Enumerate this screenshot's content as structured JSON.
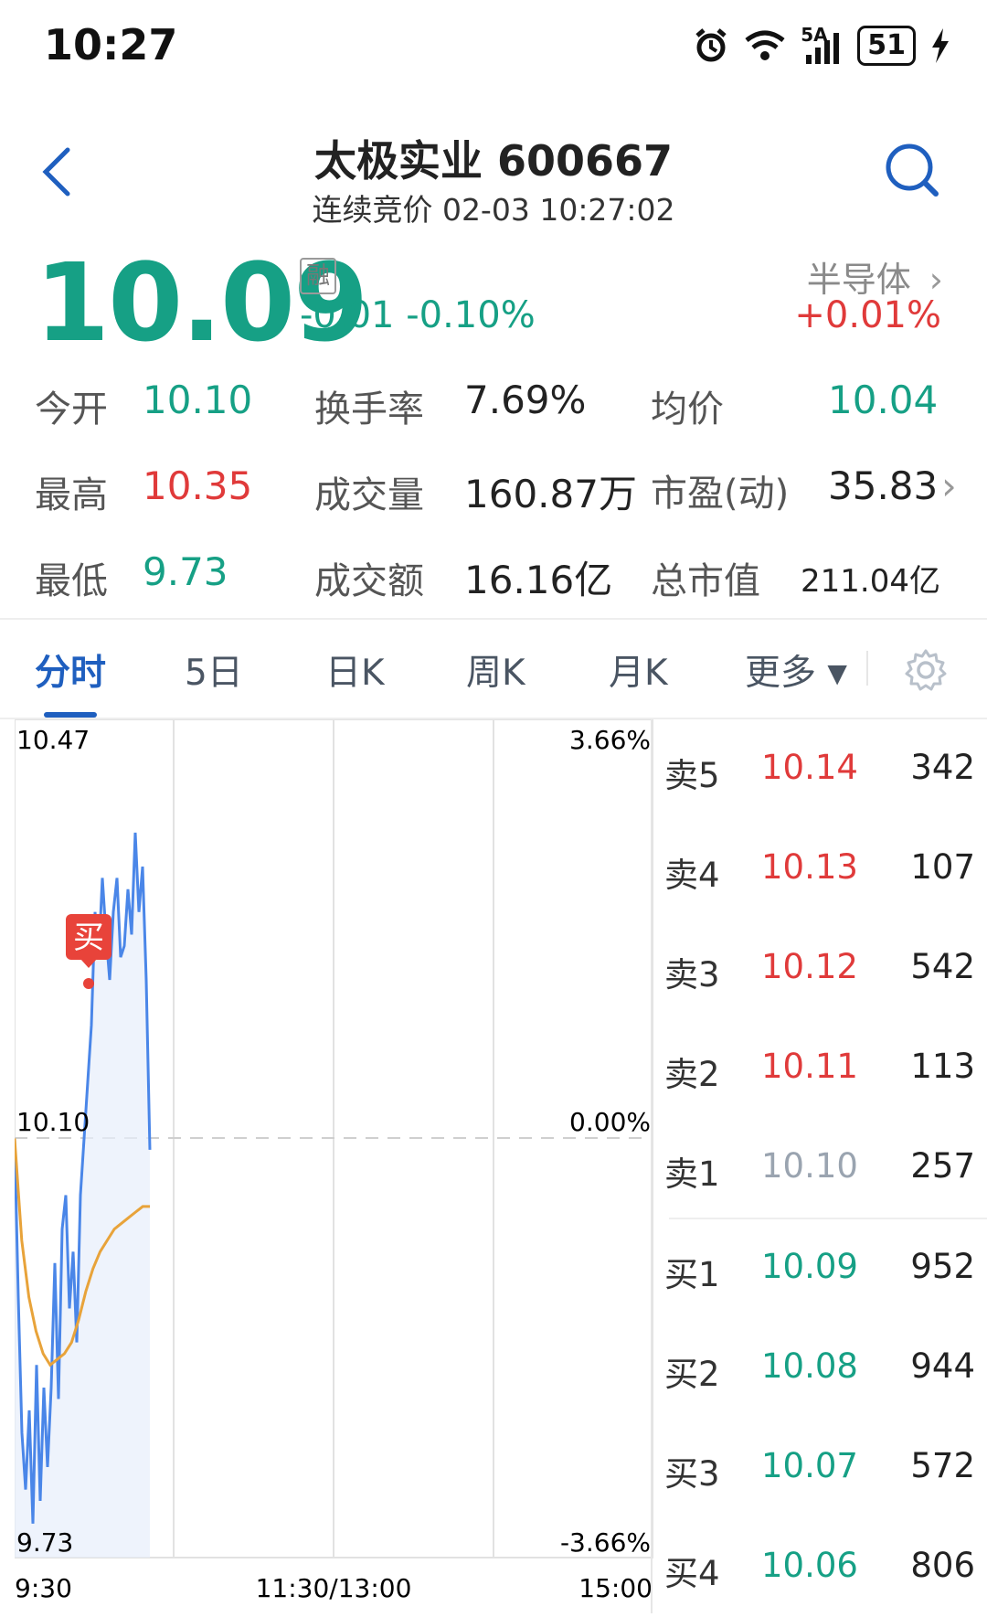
{
  "status_bar": {
    "time": "10:27",
    "battery": "51",
    "network": "5A"
  },
  "header": {
    "title": "太极实业 600667",
    "subtitle": "连续竞价 02-03 10:27:02"
  },
  "quote": {
    "price": "10.09",
    "margin_tag": "融",
    "change": "-0.01  -0.10%",
    "sector": "半导体",
    "sector_change": "+0.01%"
  },
  "stats": {
    "open_label": "今开",
    "open_value": "10.10",
    "turnover_label": "换手率",
    "turnover_value": "7.69%",
    "avg_label": "均价",
    "avg_value": "10.04",
    "high_label": "最高",
    "high_value": "10.35",
    "volume_label": "成交量",
    "volume_value": "160.87万",
    "pe_label": "市盈(动)",
    "pe_value": "35.83",
    "low_label": "最低",
    "low_value": "9.73",
    "amount_label": "成交额",
    "amount_value": "16.16亿",
    "mcap_label": "总市值",
    "mcap_value": "211.04亿"
  },
  "tabs": [
    "分时",
    "5日",
    "日K",
    "周K",
    "月K",
    "更多"
  ],
  "chart": {
    "y_top": "10.47",
    "y_mid": "10.10",
    "y_bottom": "9.73",
    "pct_top": "3.66%",
    "pct_mid": "0.00%",
    "pct_bottom": "-3.66%",
    "x_start": "9:30",
    "x_mid": "11:30/13:00",
    "x_end": "15:00",
    "buy_marker": "买"
  },
  "chart_data": {
    "type": "line",
    "ylim": [
      9.73,
      10.47
    ],
    "reference": 10.1,
    "series": [
      {
        "values": [
          10.1,
          9.96,
          9.84,
          9.79,
          9.86,
          9.76,
          9.9,
          9.78,
          9.88,
          9.81,
          9.88,
          9.99,
          9.87,
          10.02,
          10.05,
          9.95,
          10.0,
          9.92,
          10.05,
          10.1,
          10.15,
          10.2,
          10.3,
          10.26,
          10.33,
          10.28,
          10.24,
          10.3,
          10.33,
          10.26,
          10.27,
          10.32,
          10.28,
          10.37,
          10.3,
          10.34,
          10.24,
          10.09
        ]
      },
      {
        "values": [
          10.1,
          10.01,
          9.96,
          9.93,
          9.91,
          9.9,
          9.905,
          9.91,
          9.92,
          9.94,
          9.965,
          9.985,
          10.0,
          10.01,
          10.02,
          10.025,
          10.03,
          10.035,
          10.04,
          10.04
        ]
      }
    ]
  },
  "order_book": [
    {
      "label": "卖5",
      "price": "10.14",
      "volume": "342"
    },
    {
      "label": "卖4",
      "price": "10.13",
      "volume": "107"
    },
    {
      "label": "卖3",
      "price": "10.12",
      "volume": "542"
    },
    {
      "label": "卖2",
      "price": "10.11",
      "volume": "113"
    },
    {
      "label": "卖1",
      "price": "10.10",
      "volume": "257"
    },
    {
      "label": "买1",
      "price": "10.09",
      "volume": "952"
    },
    {
      "label": "买2",
      "price": "10.08",
      "volume": "944"
    },
    {
      "label": "买3",
      "price": "10.07",
      "volume": "572"
    },
    {
      "label": "买4",
      "price": "10.06",
      "volume": "806"
    }
  ],
  "colors": {
    "up": "#e03a3a",
    "down": "#16a085",
    "flat": "#9aa4b0",
    "accent": "#1f5fbf",
    "price_line": "#4a86e8",
    "avg_line": "#e8a33a"
  }
}
